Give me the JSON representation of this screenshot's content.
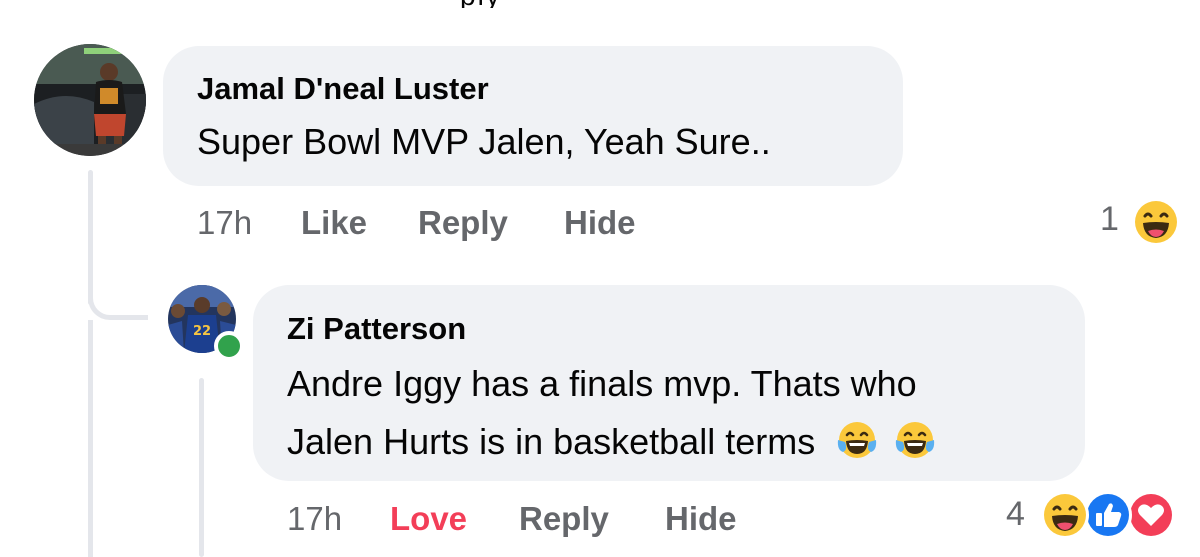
{
  "top_text": "ply",
  "comment": {
    "author": "Jamal D'neal Luster",
    "text": "Super Bowl MVP Jalen, Yeah Sure..",
    "time": "17h",
    "like_label": "Like",
    "reply_label": "Reply",
    "hide_label": "Hide",
    "reaction_count": "1",
    "reaction_icons": [
      "haha-reaction-icon"
    ]
  },
  "reply": {
    "author": "Zi Patterson",
    "text_line1": "Andre Iggy has a finals mvp.  Thats who",
    "text_line2": "Jalen Hurts is in basketball terms",
    "text_emojis": [
      "tears-of-joy-emoji",
      "tears-of-joy-emoji"
    ],
    "time": "17h",
    "react_label": "Love",
    "reply_label": "Reply",
    "hide_label": "Hide",
    "reaction_count": "4",
    "reaction_icons": [
      "haha-reaction-icon",
      "like-reaction-icon",
      "love-reaction-icon"
    ],
    "online": true
  },
  "colors": {
    "bubble": "#f0f2f5",
    "secondary_text": "#65676b",
    "love": "#f33e58",
    "online": "#31a24c",
    "like_blue": "#1877f2"
  }
}
